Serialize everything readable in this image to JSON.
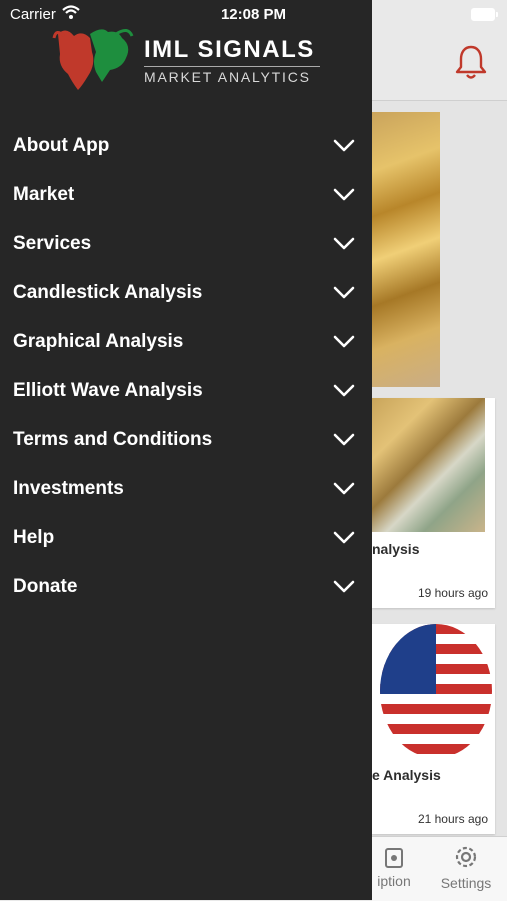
{
  "status_bar": {
    "carrier": "Carrier",
    "time": "12:08 PM"
  },
  "drawer": {
    "logo": {
      "name": "IML SIGNALS",
      "tagline": "MARKET ANALYTICS"
    },
    "menu": [
      {
        "label": "About App"
      },
      {
        "label": "Market"
      },
      {
        "label": "Services"
      },
      {
        "label": "Candlestick Analysis"
      },
      {
        "label": "Graphical Analysis"
      },
      {
        "label": "Elliott Wave Analysis"
      },
      {
        "label": "Terms and Conditions"
      },
      {
        "label": "Investments"
      },
      {
        "label": "Help"
      },
      {
        "label": "Donate"
      }
    ]
  },
  "background": {
    "cards": [
      {
        "title": "nalysis",
        "time": "19 hours ago"
      },
      {
        "title": "e Analysis",
        "time": "21 hours ago"
      }
    ],
    "tabs": [
      {
        "label": "iption"
      },
      {
        "label": "Settings"
      }
    ]
  },
  "colors": {
    "drawer_bg": "#262626",
    "accent_red": "#c0392b",
    "logo_green": "#1e8e3e"
  }
}
